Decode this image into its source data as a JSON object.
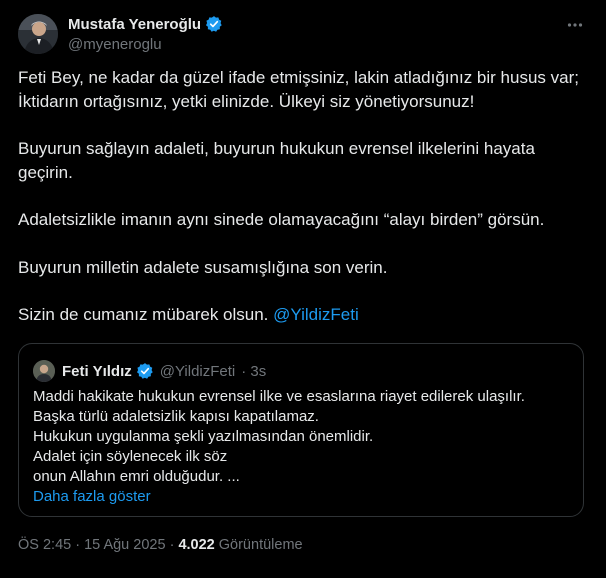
{
  "author": {
    "name": "Mustafa Yeneroğlu",
    "handle": "@myeneroglu",
    "verified": true
  },
  "tweet": {
    "paragraphs": [
      "Feti Bey, ne kadar da güzel ifade etmişsiniz, lakin atladığınız bir husus var; İktidarın ortağısınız, yetki elinizde. Ülkeyi siz yönetiyorsunuz!",
      "Buyurun sağlayın adaleti, buyurun hukukun evrensel ilkelerini hayata geçirin.",
      "Adaletsizlikle imanın aynı sinede olamayacağını “alayı birden” görsün.",
      "Buyurun milletin adalete susamışlığına son verin."
    ],
    "last_paragraph_text": "Sizin de cumanız mübarek olsun.",
    "mention": "@YildizFeti"
  },
  "quoted": {
    "name": "Feti Yıldız",
    "handle": "@YildizFeti",
    "time": "· 3s",
    "lines": [
      "Maddi hakikate hukukun evrensel ilke ve esaslarına riayet edilerek ulaşılır.",
      "Başka türlü adaletsizlik kapısı kapatılamaz.",
      "Hukukun uygulanma şekli yazılmasından önemlidir.",
      "Adalet için söylenecek ilk söz",
      "onun Allahın emri olduğudur. ..."
    ],
    "show_more": "Daha fazla göster"
  },
  "meta": {
    "time": "ÖS 2:45",
    "date": "15 Ağu 2025",
    "views_count": "4.022",
    "views_label": "Görüntüleme"
  },
  "colors": {
    "background": "#000000",
    "text": "#e7e9ea",
    "muted": "#71767b",
    "accent": "#1d9bf0",
    "border": "#2f3336"
  },
  "icons": [
    "verified-badge-icon",
    "more-options-icon"
  ]
}
